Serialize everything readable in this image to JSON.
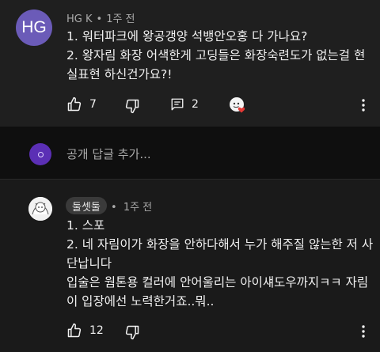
{
  "comment1": {
    "avatar_initials": "HG",
    "author": "HG K",
    "separator": "•",
    "time": "1주 전",
    "lines": [
      "1. 워터파크에 왕공갱양 석뱅안오홍 다 가나요?",
      "2. 왕자림 화장 어색한게 고딩들은 화장숙련도가 없는걸 현",
      "실표현 하신건가요?!"
    ],
    "likes": "7",
    "replies": "2",
    "icons": [
      "thumbs-up-icon",
      "thumbs-down-icon",
      "comment-icon",
      "creator-heart-icon",
      "more-vert-icon"
    ]
  },
  "reply_box": {
    "placeholder": "공개 답글 추가..."
  },
  "comment2": {
    "author": "둘셋둘",
    "separator": "•",
    "time": "1주 전",
    "lines": [
      "1. 스포",
      "2. 네 자림이가 화장을 안하다해서 누가 해주질 않는한 저 사",
      "단납니다",
      "입술은 웜톤용 컬러에 안어울리는 아이섀도우까지ㅋㅋ 자림",
      "이 입장에선 노력한거죠..뭐.."
    ],
    "likes": "12",
    "icons": [
      "thumbs-up-icon",
      "thumbs-down-icon",
      "more-vert-icon"
    ]
  },
  "colors": {
    "background": "#0f0f0f",
    "card_top": "#1f1f1f",
    "card_bottom": "#1a1a1a",
    "avatar_hg": "#6b5bb8",
    "avatar_reply": "#5b2fb5",
    "text_primary": "#f1f1f1",
    "text_secondary": "#aaaaaa",
    "heart": "#e53935"
  }
}
